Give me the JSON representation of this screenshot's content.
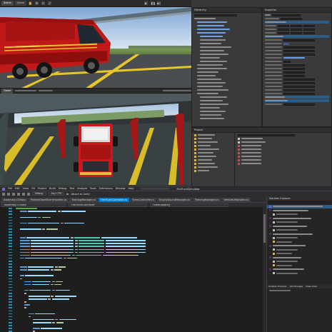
{
  "unity": {
    "scene_tabs": [
      "Scene",
      "Game"
    ],
    "hierarchy_title": "Hierarchy",
    "inspector_title": "Inspector",
    "project_title": "Project"
  },
  "vs": {
    "menu": [
      "File",
      "Edit",
      "View",
      "Git",
      "Project",
      "Build",
      "Debug",
      "Test",
      "Analyze",
      "Tools",
      "Extensions",
      "Window",
      "Help"
    ],
    "project_name": "FireTruckSimulator",
    "toolbar": {
      "config": "Debug",
      "platform": "Any CPU",
      "attach": "Attach to Unity"
    },
    "tabs": [
      "Assembly-CSharp",
      "PointerDownEventHandler.cs",
      "TrainingManager.cs",
      "FireTruckController.cs",
      "SirenController.cs",
      "EngineSoundManager.cs",
      "TrainingManager.cs",
      "VehicleUIHandler.cs"
    ],
    "active_tab_index": 3,
    "nav": [
      "Assembly-CSharp",
      "FireTruckController",
      "FixedUpdate()"
    ],
    "side_panel_title": "Solution Explorer",
    "side_panel_tabs": [
      "Solution Explorer",
      "Git Changes",
      "Class View"
    ],
    "accent_color": "#007acc"
  }
}
